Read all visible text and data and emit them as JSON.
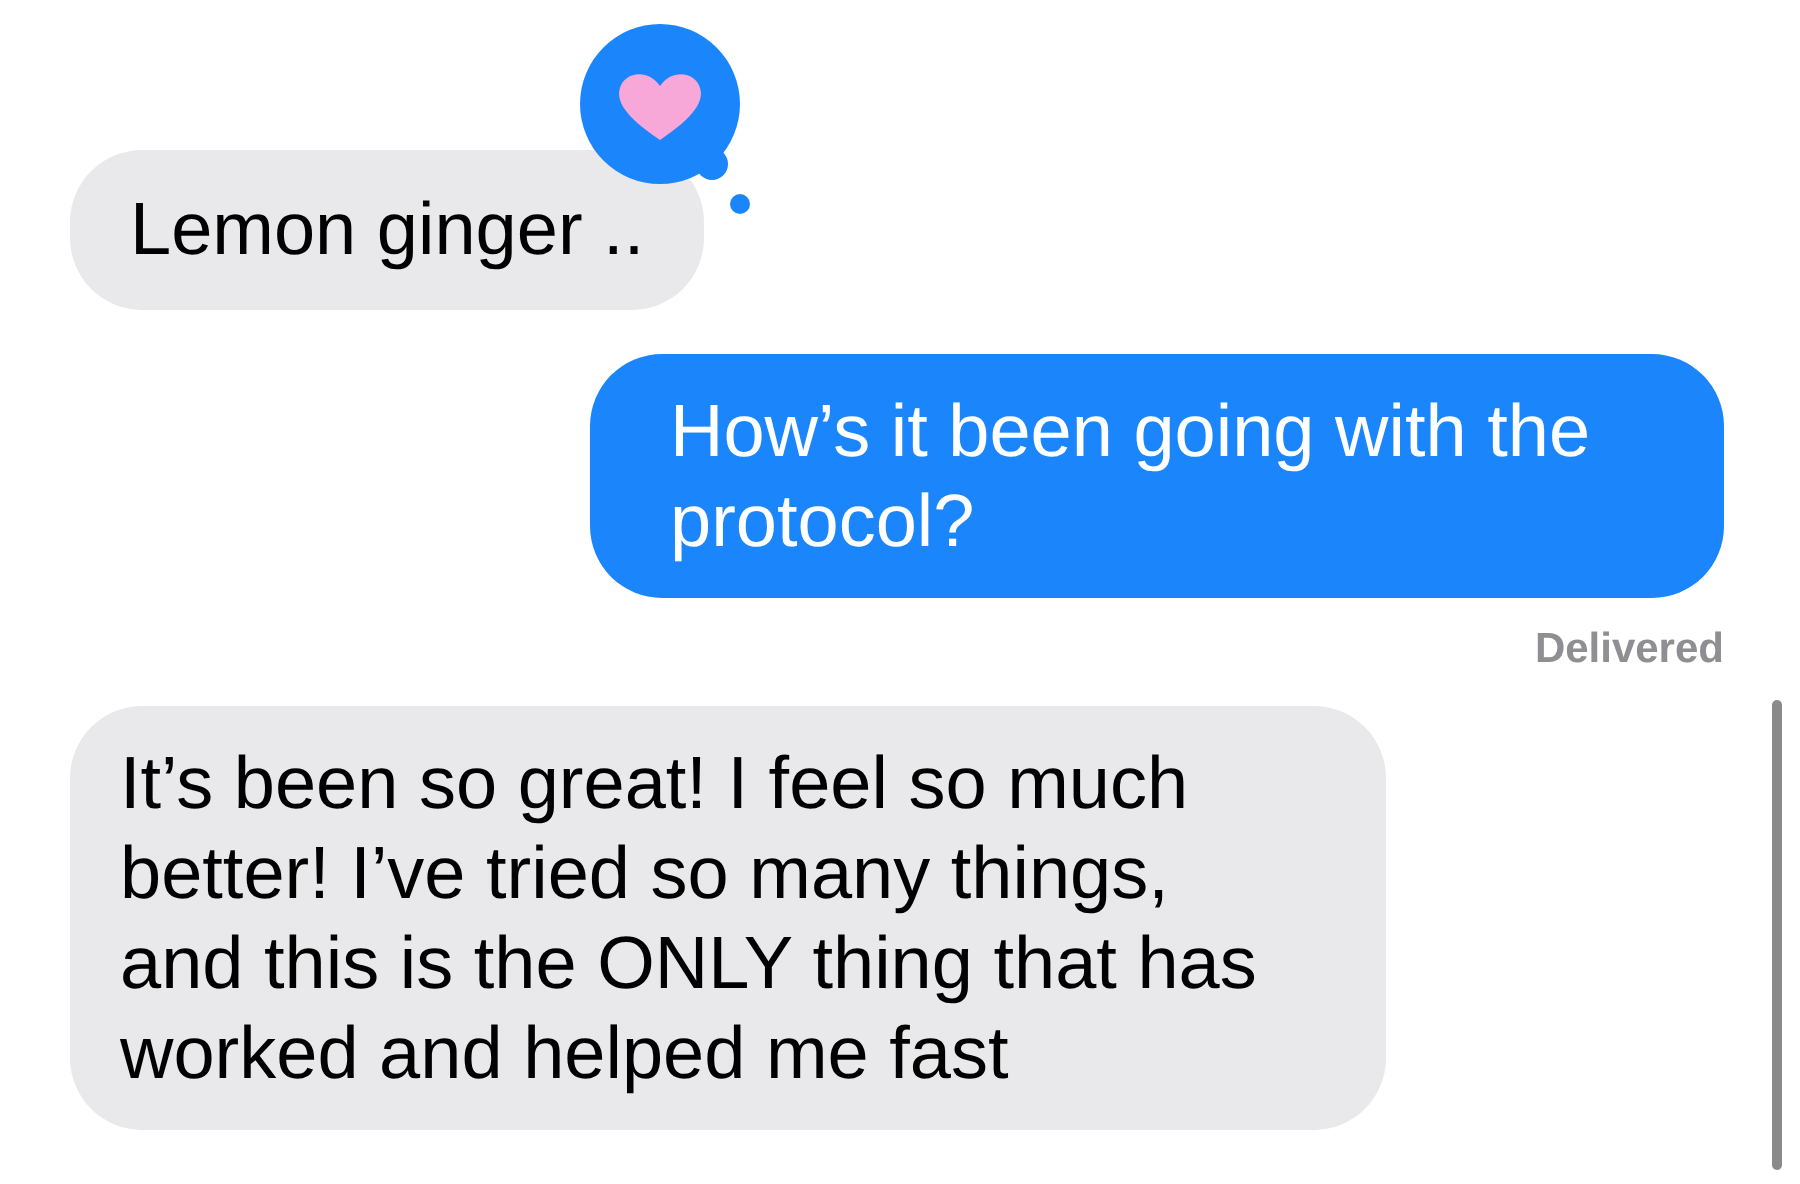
{
  "messages": [
    {
      "kind": "received",
      "text": "Lemon ginger ..",
      "heart_reaction": true
    },
    {
      "kind": "sent",
      "text": "How’s it been going with the protocol?",
      "status": "Delivered"
    },
    {
      "kind": "received",
      "text": "It’s been so great! I feel so much better! I’ve tried so many things, and this is the ONLY thing that has worked and helped me fast"
    }
  ]
}
